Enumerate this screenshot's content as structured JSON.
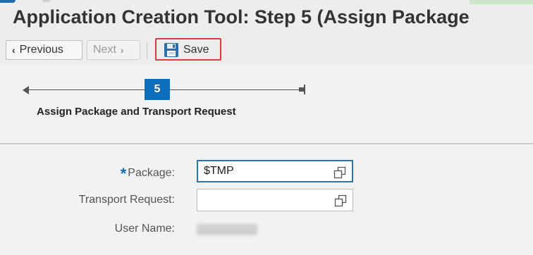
{
  "header": {
    "title": "Application Creation Tool: Step 5  (Assign Package"
  },
  "toolbar": {
    "previous_label": "Previous",
    "next_label": "Next",
    "save_label": "Save"
  },
  "wizard": {
    "current_step_number": "5",
    "current_step_label": "Assign Package and Transport Request"
  },
  "form": {
    "package": {
      "label": "Package:",
      "required": true,
      "value": "$TMP",
      "icon": "value-help-icon"
    },
    "transport_request": {
      "label": "Transport Request:",
      "value": "",
      "icon": "value-help-icon"
    },
    "user_name": {
      "label": "User Name:",
      "value_state": "blurred"
    }
  },
  "colors": {
    "accent": "#0a6ebd",
    "highlight": "#e0393e",
    "field_focus_border": "#2a74b5"
  }
}
